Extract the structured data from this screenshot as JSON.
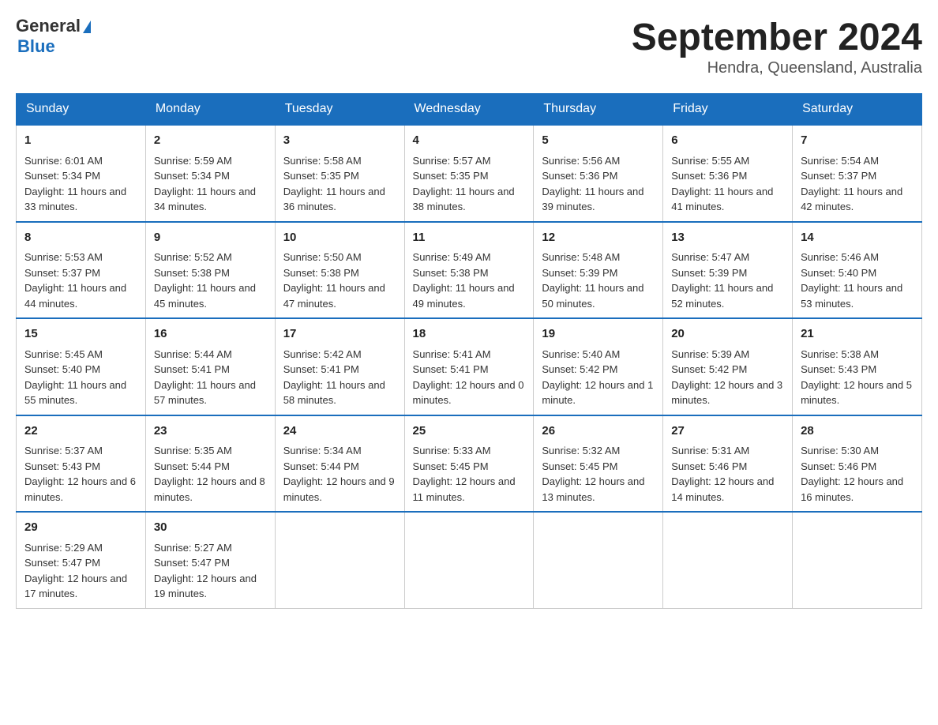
{
  "logo": {
    "text_general": "General",
    "text_blue": "Blue"
  },
  "header": {
    "month_year": "September 2024",
    "location": "Hendra, Queensland, Australia"
  },
  "weekdays": [
    "Sunday",
    "Monday",
    "Tuesday",
    "Wednesday",
    "Thursday",
    "Friday",
    "Saturday"
  ],
  "weeks": [
    [
      {
        "day": "1",
        "sunrise": "6:01 AM",
        "sunset": "5:34 PM",
        "daylight": "11 hours and 33 minutes."
      },
      {
        "day": "2",
        "sunrise": "5:59 AM",
        "sunset": "5:34 PM",
        "daylight": "11 hours and 34 minutes."
      },
      {
        "day": "3",
        "sunrise": "5:58 AM",
        "sunset": "5:35 PM",
        "daylight": "11 hours and 36 minutes."
      },
      {
        "day": "4",
        "sunrise": "5:57 AM",
        "sunset": "5:35 PM",
        "daylight": "11 hours and 38 minutes."
      },
      {
        "day": "5",
        "sunrise": "5:56 AM",
        "sunset": "5:36 PM",
        "daylight": "11 hours and 39 minutes."
      },
      {
        "day": "6",
        "sunrise": "5:55 AM",
        "sunset": "5:36 PM",
        "daylight": "11 hours and 41 minutes."
      },
      {
        "day": "7",
        "sunrise": "5:54 AM",
        "sunset": "5:37 PM",
        "daylight": "11 hours and 42 minutes."
      }
    ],
    [
      {
        "day": "8",
        "sunrise": "5:53 AM",
        "sunset": "5:37 PM",
        "daylight": "11 hours and 44 minutes."
      },
      {
        "day": "9",
        "sunrise": "5:52 AM",
        "sunset": "5:38 PM",
        "daylight": "11 hours and 45 minutes."
      },
      {
        "day": "10",
        "sunrise": "5:50 AM",
        "sunset": "5:38 PM",
        "daylight": "11 hours and 47 minutes."
      },
      {
        "day": "11",
        "sunrise": "5:49 AM",
        "sunset": "5:38 PM",
        "daylight": "11 hours and 49 minutes."
      },
      {
        "day": "12",
        "sunrise": "5:48 AM",
        "sunset": "5:39 PM",
        "daylight": "11 hours and 50 minutes."
      },
      {
        "day": "13",
        "sunrise": "5:47 AM",
        "sunset": "5:39 PM",
        "daylight": "11 hours and 52 minutes."
      },
      {
        "day": "14",
        "sunrise": "5:46 AM",
        "sunset": "5:40 PM",
        "daylight": "11 hours and 53 minutes."
      }
    ],
    [
      {
        "day": "15",
        "sunrise": "5:45 AM",
        "sunset": "5:40 PM",
        "daylight": "11 hours and 55 minutes."
      },
      {
        "day": "16",
        "sunrise": "5:44 AM",
        "sunset": "5:41 PM",
        "daylight": "11 hours and 57 minutes."
      },
      {
        "day": "17",
        "sunrise": "5:42 AM",
        "sunset": "5:41 PM",
        "daylight": "11 hours and 58 minutes."
      },
      {
        "day": "18",
        "sunrise": "5:41 AM",
        "sunset": "5:41 PM",
        "daylight": "12 hours and 0 minutes."
      },
      {
        "day": "19",
        "sunrise": "5:40 AM",
        "sunset": "5:42 PM",
        "daylight": "12 hours and 1 minute."
      },
      {
        "day": "20",
        "sunrise": "5:39 AM",
        "sunset": "5:42 PM",
        "daylight": "12 hours and 3 minutes."
      },
      {
        "day": "21",
        "sunrise": "5:38 AM",
        "sunset": "5:43 PM",
        "daylight": "12 hours and 5 minutes."
      }
    ],
    [
      {
        "day": "22",
        "sunrise": "5:37 AM",
        "sunset": "5:43 PM",
        "daylight": "12 hours and 6 minutes."
      },
      {
        "day": "23",
        "sunrise": "5:35 AM",
        "sunset": "5:44 PM",
        "daylight": "12 hours and 8 minutes."
      },
      {
        "day": "24",
        "sunrise": "5:34 AM",
        "sunset": "5:44 PM",
        "daylight": "12 hours and 9 minutes."
      },
      {
        "day": "25",
        "sunrise": "5:33 AM",
        "sunset": "5:45 PM",
        "daylight": "12 hours and 11 minutes."
      },
      {
        "day": "26",
        "sunrise": "5:32 AM",
        "sunset": "5:45 PM",
        "daylight": "12 hours and 13 minutes."
      },
      {
        "day": "27",
        "sunrise": "5:31 AM",
        "sunset": "5:46 PM",
        "daylight": "12 hours and 14 minutes."
      },
      {
        "day": "28",
        "sunrise": "5:30 AM",
        "sunset": "5:46 PM",
        "daylight": "12 hours and 16 minutes."
      }
    ],
    [
      {
        "day": "29",
        "sunrise": "5:29 AM",
        "sunset": "5:47 PM",
        "daylight": "12 hours and 17 minutes."
      },
      {
        "day": "30",
        "sunrise": "5:27 AM",
        "sunset": "5:47 PM",
        "daylight": "12 hours and 19 minutes."
      },
      null,
      null,
      null,
      null,
      null
    ]
  ],
  "labels": {
    "sunrise": "Sunrise:",
    "sunset": "Sunset:",
    "daylight": "Daylight:"
  }
}
